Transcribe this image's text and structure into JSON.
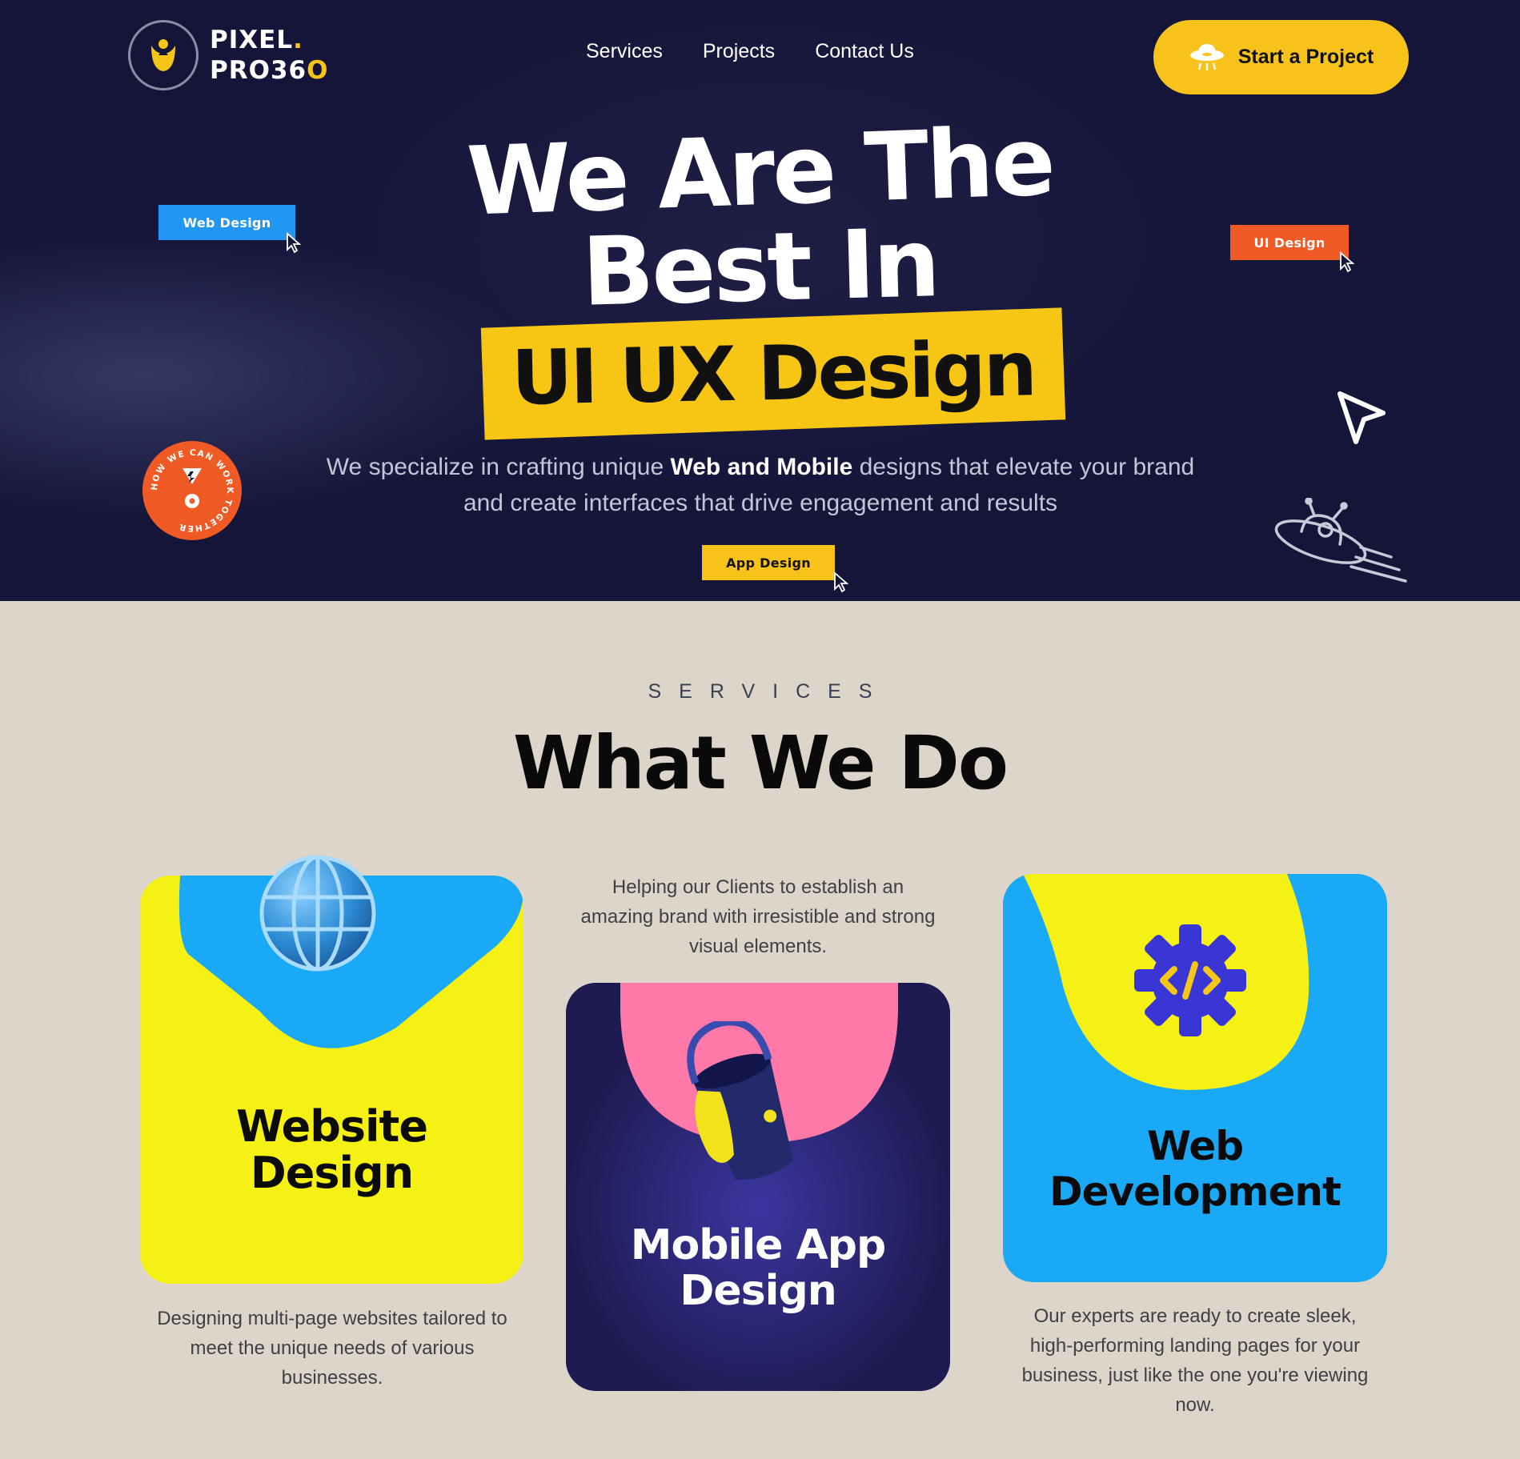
{
  "brand": {
    "line1": "PIXEL",
    "line1_dot": ".",
    "line2_prefix": "PRO36",
    "line2_o": "O"
  },
  "nav": {
    "items": [
      "Services",
      "Projects",
      "Contact Us"
    ]
  },
  "cta": {
    "label": "Start a Project",
    "icon": "ufo-icon"
  },
  "hero": {
    "headline_line1": "We Are The",
    "headline_line2": "Best In",
    "highlight": "UI UX Design",
    "desc_part1": "We specialize in crafting unique ",
    "desc_bold": "Web and Mobile",
    "desc_part2": " designs that elevate your brand and create interfaces that drive engagement and results",
    "tags": {
      "web": "Web Design",
      "ui": "UI Design",
      "app": "App Design"
    },
    "badge_text": "HOW WE CAN WORK TOGETHER"
  },
  "services": {
    "kicker": "SERVICES",
    "title": "What We Do",
    "cards": [
      {
        "title_line1": "Website",
        "title_line2": "Design",
        "desc": "Designing multi-page websites tailored to meet the unique needs of various businesses."
      },
      {
        "title_line1": "Mobile App",
        "title_line2": "Design",
        "desc": "Helping our Clients to establish an amazing brand with irresistible and strong visual elements."
      },
      {
        "title_line1": "Web",
        "title_line2": "Development",
        "desc": "Our experts are ready to create sleek, high-performing landing pages for your business, just like the one you're viewing now."
      }
    ]
  },
  "colors": {
    "hero_bg": "#15153a",
    "accent_yellow": "#f7c31b",
    "accent_blue": "#2196f3",
    "accent_orange": "#f05a24",
    "card_yellow": "#f5f114",
    "card_navy": "#1e1b52",
    "card_blue": "#1aa9f7",
    "page_bg": "#ddd4ca"
  }
}
